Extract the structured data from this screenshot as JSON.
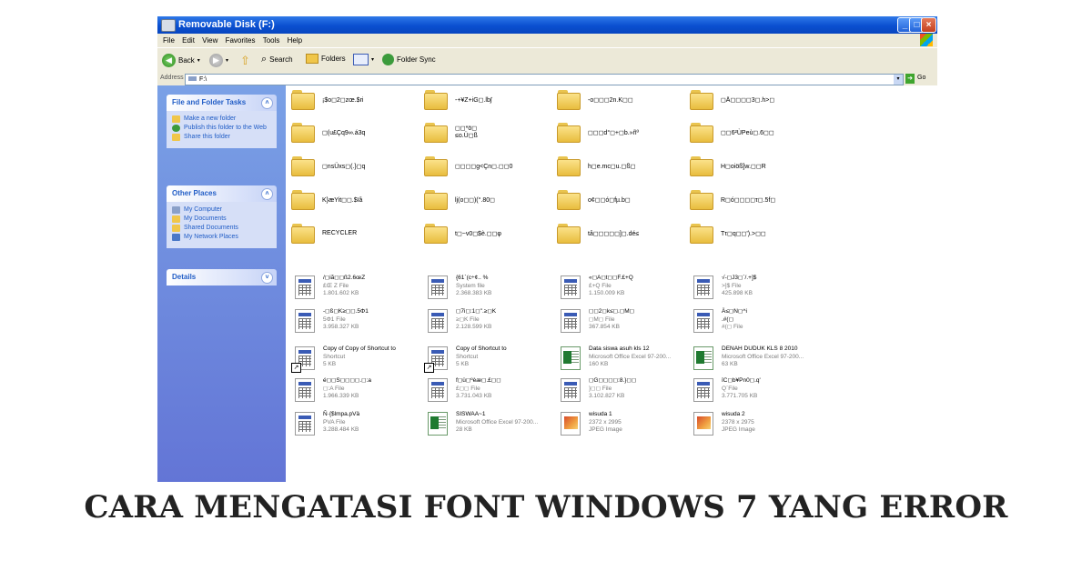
{
  "window": {
    "title": "Removable Disk (F:)",
    "menu": [
      "File",
      "Edit",
      "View",
      "Favorites",
      "Tools",
      "Help"
    ],
    "toolbar": {
      "back": "Back",
      "search": "Search",
      "folders": "Folders",
      "folder_sync": "Folder Sync"
    },
    "address": {
      "label": "Address",
      "value": "F:\\",
      "go": "Go"
    }
  },
  "sidebar": {
    "file_folder_tasks": {
      "title": "File and Folder Tasks",
      "items": [
        "Make a new folder",
        "Publish this folder to the Web",
        "Share this folder"
      ]
    },
    "other_places": {
      "title": "Other Places",
      "items": [
        "My Computer",
        "My Documents",
        "Shared Documents",
        "My Network Places"
      ]
    },
    "details": {
      "title": "Details"
    }
  },
  "folders": [
    "¡$o◻2◻zœ.$ri",
    "-+¥Z+iG◻.lb∫",
    "-o◻◻◻2n.K◻◻",
    "◻Ä◻◻◻◻3◻.h>◻",
    "◻(u£Çq9∞.á3q",
    "◻◻*ö◻\n≤o.Ü◻ß",
    "◻◻◻d°◻+◻b.»ñº",
    "◻◻6²ÙPeù◻.6◻◻",
    "◻nsÜxs◻(.}◻q",
    "◻◻◻◻g<Çn◻.◻◻0",
    "h◻e.mc◻u.◻ß◻",
    "H◻oiöß]w.◻◻R",
    "K}æYit◻◻.$ïå",
    "lj(o◻◻)(°.80◻",
    "o¢◻◻ó◻fµ.b◻",
    "R◻ó◻◻◻◻τ◻.5f◻",
    "RECYCLER",
    "t◻~v0◻$è.◻◻φ",
    "tå◻◻◻◻◻]◻.dé≤",
    "Tτ◻q◻◻').>◻◻"
  ],
  "files": [
    {
      "name": "/◻iã◻◻ß2.6œZ",
      "type": "£Œ Z File",
      "size": "1.801.602 KB",
      "icon": "file-icon"
    },
    {
      "name": "{61`(c÷¢.. %",
      "type": "System file",
      "size": "2.368.383 KB",
      "icon": "file-icon"
    },
    {
      "name": "«◻A◻t◻◻F.£+Q",
      "type": "£+Q File",
      "size": "1.150.009 KB",
      "icon": "file-icon"
    },
    {
      "name": "√-◻J3◻`/.+]$",
      "type": ">]$ File",
      "size": "425.898 KB",
      "icon": "file-icon"
    },
    {
      "name": "-◻ß◻K≥◻◻.5Φ1",
      "type": "5Φ1 File",
      "size": "3.958.327 KB",
      "icon": "file-icon"
    },
    {
      "name": "◻7i◻:1◻\".≥◻K",
      "type": "≥◻K File",
      "size": "2.128.599 KB",
      "icon": "file-icon"
    },
    {
      "name": "◻◻2◻k≤◻.◻M◻",
      "type": "◻M◻ File",
      "size": "367.854 KB",
      "icon": "file-icon"
    },
    {
      "name": "Ä≤◻N◻^i\n.#(◻",
      "type": "#(◻ File",
      "size": "",
      "icon": "file-icon"
    },
    {
      "name": "Copy of Copy of Shortcut to",
      "type": "Shortcut",
      "size": "5 KB",
      "icon": "shortcut-icon"
    },
    {
      "name": "Copy of Shortcut to",
      "type": "Shortcut",
      "size": "5 KB",
      "icon": "shortcut-icon"
    },
    {
      "name": "Data siswa asuh kls 12",
      "type": "Microsoft Office Excel 97-200...",
      "size": "160 KB",
      "icon": "excel-icon"
    },
    {
      "name": "DENAH DUDUK KLS 8 2010",
      "type": "Microsoft Office Excel 97-200...",
      "size": "63 KB",
      "icon": "excel-icon"
    },
    {
      "name": "é◻◻S◻◻◻◻.◻:a",
      "type": "◻:A File",
      "size": "1.966.339 KB",
      "icon": "file-icon"
    },
    {
      "name": "f◻ü◻ºèæ◻.£◻◻",
      "type": "£◻◻ File",
      "size": "3.731.043 KB",
      "icon": "file-icon"
    },
    {
      "name": "◻G◻◻◻◻:8.}◻◻",
      "type": "}◻◻ File",
      "size": "3.102.827 KB",
      "icon": "file-icon"
    },
    {
      "name": "ïC◻b¥Pn0◻.q'",
      "type": "Q`File",
      "size": "3.771.705 KB",
      "icon": "file-icon"
    },
    {
      "name": "Ñ·{$lmpa.pVä",
      "type": "PVA File",
      "size": "3.288.484 KB",
      "icon": "file-icon"
    },
    {
      "name": "SISWAA~1",
      "type": "Microsoft Office Excel 97-200...",
      "size": "28 KB",
      "icon": "excel-icon"
    },
    {
      "name": "wisuda 1",
      "type": "2372 x 2995",
      "size": "JPEG Image",
      "icon": "jpeg-icon"
    },
    {
      "name": "wisuda 2",
      "type": "2378 x 2975",
      "size": "JPEG Image",
      "icon": "jpeg-icon"
    }
  ],
  "headline": "CARA MENGATASI FONT WINDOWS 7 YANG ERROR"
}
